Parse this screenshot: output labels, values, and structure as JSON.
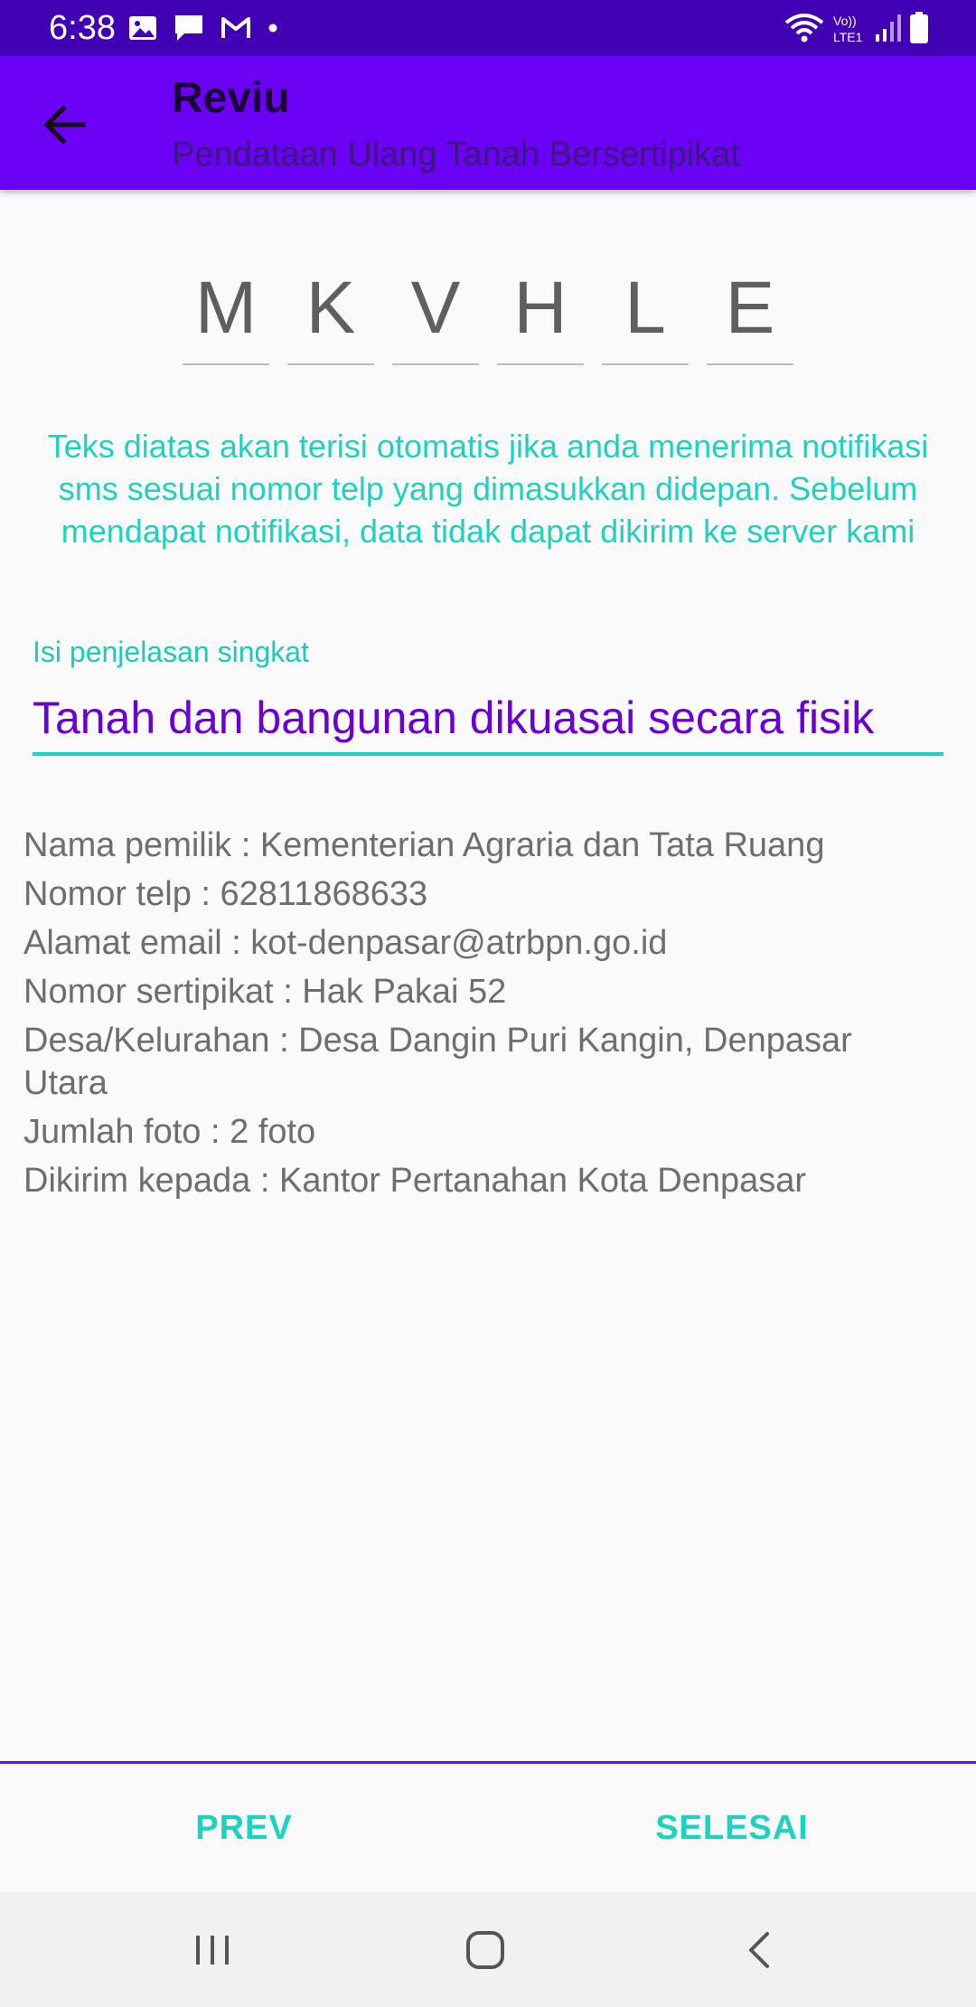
{
  "status_bar": {
    "time": "6:38",
    "network_label": "Vo)) LTE1"
  },
  "app_bar": {
    "title": "Reviu",
    "subtitle": "Pendataan Ulang Tanah Bersertipikat"
  },
  "code": {
    "characters": [
      "M",
      "K",
      "V",
      "H",
      "L",
      "E"
    ]
  },
  "info_text": "Teks diatas akan terisi otomatis jika anda menerima notifikasi sms sesuai nomor telp yang dimasukkan didepan. Sebelum mendapat notifikasi, data tidak dapat dikirim ke server kami",
  "description": {
    "label": "Isi penjelasan singkat",
    "value": "Tanah dan bangunan dikuasai secara fisik"
  },
  "details": [
    "Nama pemilik : Kementerian Agraria dan Tata Ruang",
    "Nomor telp : 62811868633",
    "Alamat email : kot-denpasar@atrbpn.go.id",
    "Nomor sertipikat : Hak Pakai 52",
    "Desa/Kelurahan : Desa Dangin Puri Kangin, Denpasar Utara",
    "Jumlah foto : 2 foto",
    "Dikirim kepada : Kantor Pertanahan Kota Denpasar"
  ],
  "actions": {
    "prev_label": "PREV",
    "done_label": "SELESAI"
  },
  "colors": {
    "status_bar": "#4100b3",
    "app_bar": "#6a00f4",
    "accent_teal": "#1fd1c1",
    "input_text": "#6a00d4"
  },
  "icons": {
    "status_left": [
      "gallery-icon",
      "message-icon",
      "gmail-icon",
      "dot-icon"
    ],
    "status_right": [
      "wifi-icon",
      "lte-icon",
      "signal-icon",
      "battery-icon"
    ],
    "app_bar": "back-arrow-icon",
    "nav": [
      "recent-apps-icon",
      "home-icon",
      "back-icon"
    ]
  }
}
